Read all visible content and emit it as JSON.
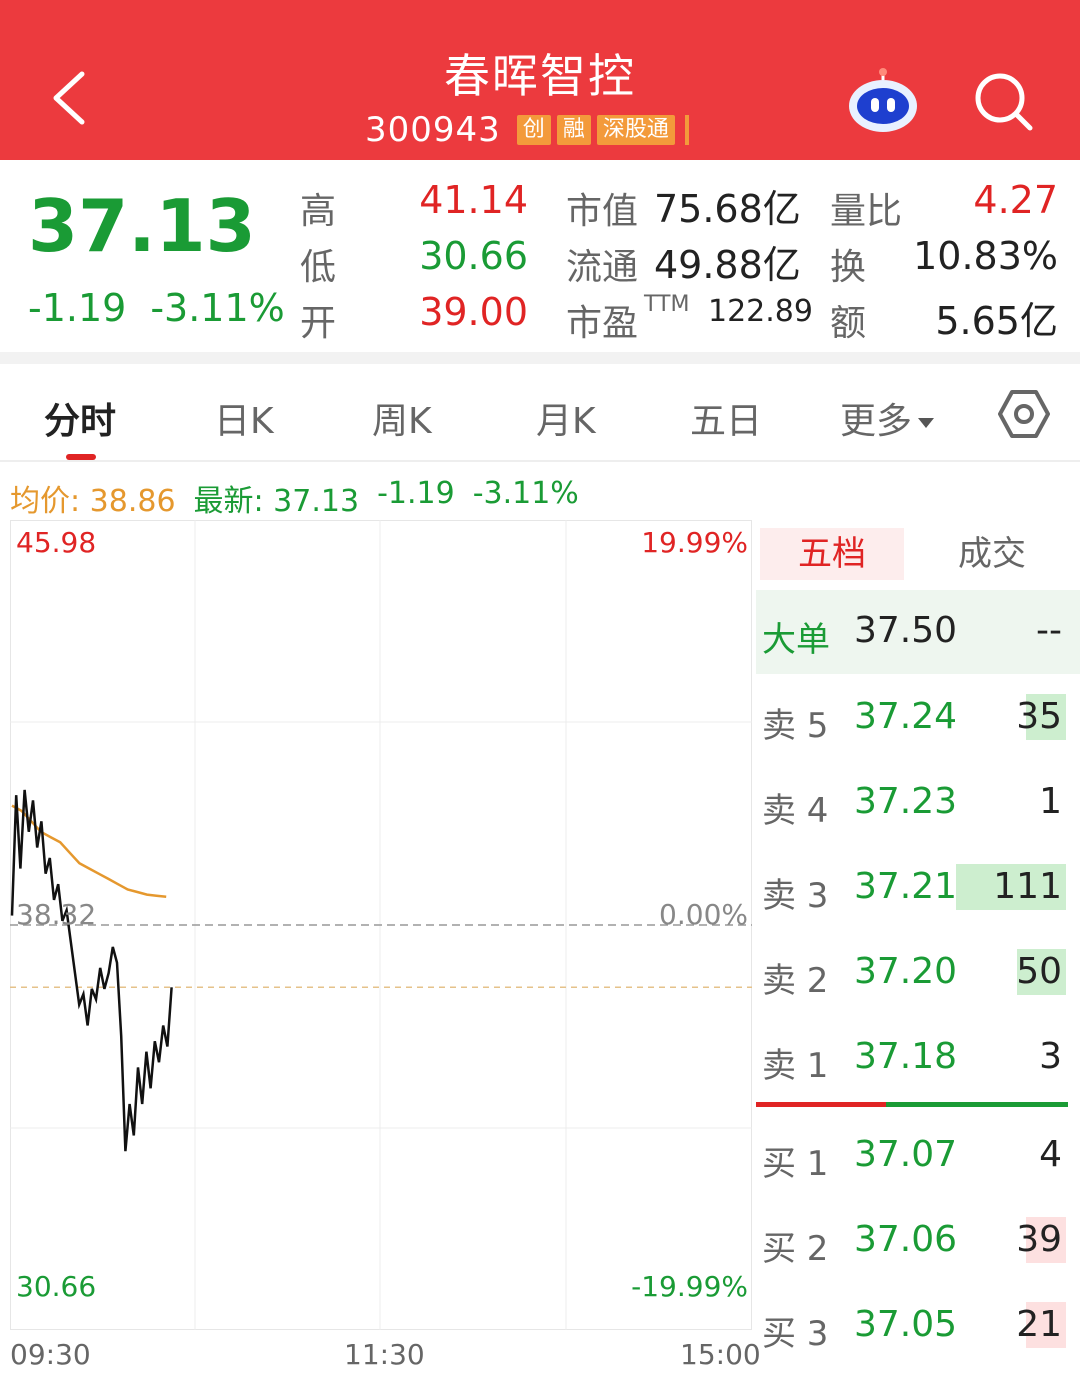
{
  "header": {
    "title": "春晖智控",
    "code": "300943",
    "tags": [
      "创",
      "融",
      "深股通"
    ]
  },
  "quote": {
    "price": "37.13",
    "change": "-1.19",
    "change_pct": "-3.11%",
    "high_label": "高",
    "high": "41.14",
    "low_label": "低",
    "low": "30.66",
    "open_label": "开",
    "open": "39.00",
    "mcap_label": "市值",
    "mcap": "75.68亿",
    "float_label": "流通",
    "float": "49.88亿",
    "pe_label": "市盈",
    "pe_sup": "TTM",
    "pe": "122.89",
    "volratio_label": "量比",
    "volratio": "4.27",
    "turnover_label": "换",
    "turnover": "10.83%",
    "amount_label": "额",
    "amount": "5.65亿"
  },
  "tabs": [
    "分时",
    "日K",
    "周K",
    "月K",
    "五日",
    "更多"
  ],
  "avg_row": {
    "avg_label": "均价: 38.86",
    "latest_label": "最新: 37.13",
    "change": "-1.19",
    "change_pct": "-3.11%"
  },
  "chart_data": {
    "type": "line",
    "ylim": [
      30.66,
      45.98
    ],
    "prev_close": 38.32,
    "y_labels": {
      "top": "45.98",
      "mid": "38.32",
      "bottom": "30.66"
    },
    "pct_labels": {
      "top": "19.99%",
      "mid": "0.00%",
      "bottom": "-19.99%"
    },
    "x_labels": [
      "09:30",
      "11:30",
      "15:00"
    ],
    "series": [
      {
        "values": [
          38.5,
          40.8,
          39.4,
          40.9,
          40.1,
          40.7,
          39.8,
          40.3,
          39.3,
          39.6,
          38.8,
          39.1,
          38.4,
          38.6,
          38.0,
          37.4,
          36.8,
          37.0,
          36.4,
          37.1,
          36.9,
          37.5,
          37.1,
          37.4,
          37.9,
          37.6,
          36.2,
          34.0,
          34.9,
          34.3,
          35.6,
          34.9,
          35.9,
          35.2,
          36.1,
          35.7,
          36.4,
          36.0,
          37.13
        ]
      },
      {
        "values": [
          40.6,
          40.5,
          40.3,
          40.1,
          40.0,
          39.9,
          39.7,
          39.5,
          39.4,
          39.3,
          39.2,
          39.1,
          39.0,
          38.95,
          38.9,
          38.88,
          38.86
        ]
      }
    ]
  },
  "orderbook": {
    "tab_active": "五档",
    "tab_other": "成交",
    "big_label": "大单",
    "big_price": "37.50",
    "big_vol": "--",
    "asks": [
      {
        "label": "卖 5",
        "price": "37.24",
        "vol": "35",
        "ratio": 0.32
      },
      {
        "label": "卖 4",
        "price": "37.23",
        "vol": "1",
        "ratio": 0.0
      },
      {
        "label": "卖 3",
        "price": "37.21",
        "vol": "111",
        "ratio": 1.0
      },
      {
        "label": "卖 2",
        "price": "37.20",
        "vol": "50",
        "ratio": 0.45
      },
      {
        "label": "卖 1",
        "price": "37.18",
        "vol": "3",
        "ratio": 0.0
      }
    ],
    "bids": [
      {
        "label": "买 1",
        "price": "37.07",
        "vol": "4",
        "ratio": 0.0
      },
      {
        "label": "买 2",
        "price": "37.06",
        "vol": "39",
        "ratio": 0.35
      },
      {
        "label": "买 3",
        "price": "37.05",
        "vol": "21",
        "ratio": 0.19
      }
    ],
    "colors": {
      "ask_bar": "#cdeecf",
      "bid_bar": "#fde0e0"
    }
  }
}
